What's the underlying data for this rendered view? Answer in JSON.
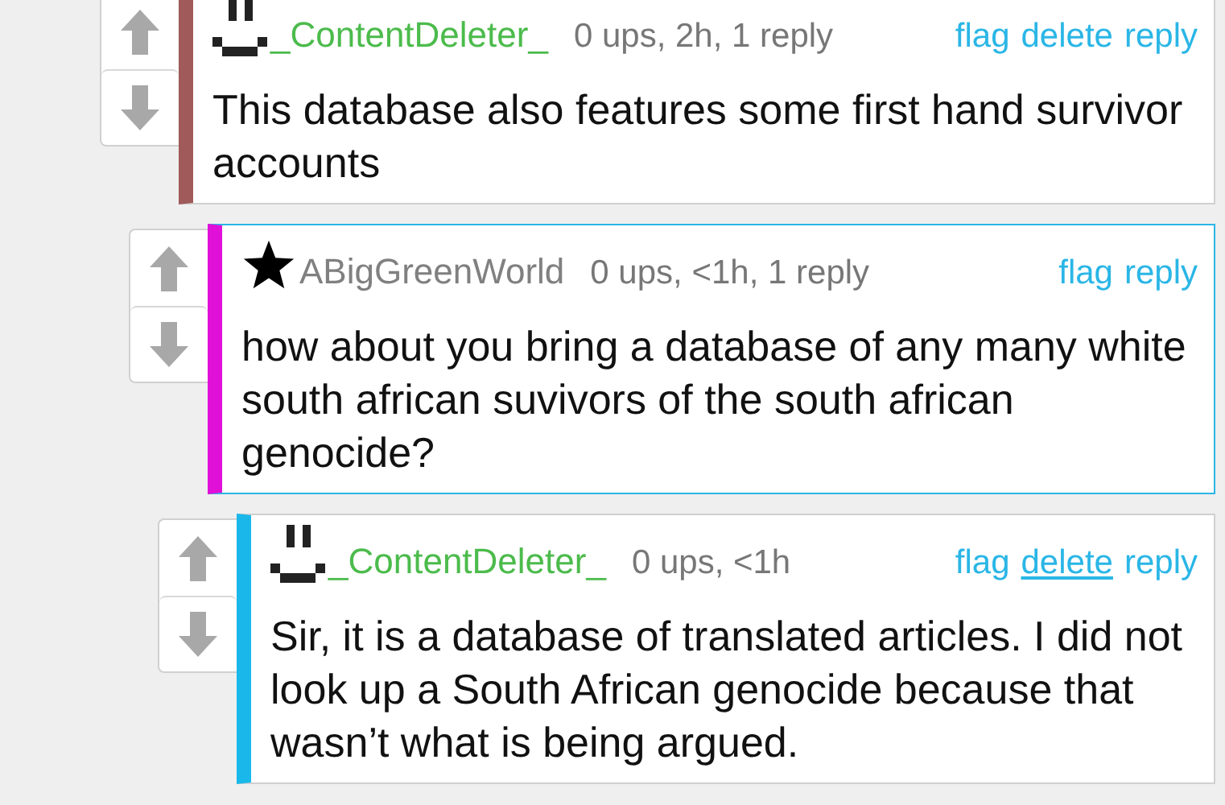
{
  "comments": [
    {
      "kind": "pixel-face",
      "own": true,
      "username": "_ContentDeleter_",
      "meta": "0 ups, 2h, 1 reply",
      "color": "#a05a5a",
      "highlighted": false,
      "actions": [
        {
          "label": "flag",
          "underlined": false
        },
        {
          "label": "delete",
          "underlined": false
        },
        {
          "label": "reply",
          "underlined": false
        }
      ],
      "text": "This database also features some first hand survivor accounts",
      "children": [
        {
          "kind": "star",
          "own": false,
          "username": "ABigGreenWorld",
          "meta": "0 ups, <1h, 1 reply",
          "color": "#e010d8",
          "highlighted": true,
          "actions": [
            {
              "label": "flag",
              "underlined": false
            },
            {
              "label": "reply",
              "underlined": false
            }
          ],
          "text": "how about you bring a database of any many white south african suvivors of the south african genocide?",
          "children": [
            {
              "kind": "pixel-face",
              "own": true,
              "username": "_ContentDeleter_",
              "meta": "0 ups, <1h",
              "color": "#1ab8ea",
              "highlighted": false,
              "actions": [
                {
                  "label": "flag",
                  "underlined": false
                },
                {
                  "label": "delete",
                  "underlined": true
                },
                {
                  "label": "reply",
                  "underlined": false
                }
              ],
              "text": "Sir, it is a database of translated articles. I did not look up a South African genocide because that wasn’t what is being argued."
            }
          ]
        }
      ]
    }
  ]
}
